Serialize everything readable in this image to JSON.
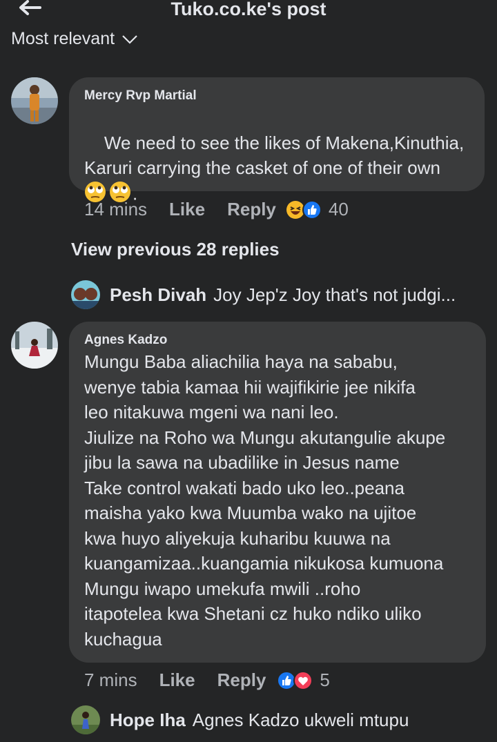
{
  "header": {
    "title": "Tuko.co.ke's post",
    "back_icon": "arrow-left-icon"
  },
  "sort": {
    "label": "Most relevant"
  },
  "comments": [
    {
      "author": "Mercy Rvp Martial",
      "text": "We need to see the likes of Makena,Kinuthia,\nKaruri carrying the casket of one of their own\n",
      "emoji_suffix": ".",
      "time": "14 mins",
      "like_label": "Like",
      "reply_label": "Reply",
      "reaction_count": "40",
      "reactions": [
        "haha",
        "like"
      ]
    },
    {
      "author": "Agnes Kadzo",
      "text": "Mungu Baba aliachilia haya na sababu,\nwenye tabia kamaa hii wajifikirie jee nikifa\nleo nitakuwa mgeni wa nani leo.\nJiulize na Roho wa Mungu akutangulie akupe\njibu la sawa na ubadilike in Jesus name\nTake control wakati bado uko leo..peana\nmaisha yako kwa Muumba wako na ujitoe\nkwa huyo aliyekuja kuharibu kuuwa na\nkuangamizaa..kuangamia nikukosa kumuona\nMungu iwapo umekufa mwili ..roho\nitapotelea kwa Shetani cz huko ndiko uliko\nkuchagua",
      "time": "7 mins",
      "like_label": "Like",
      "reply_label": "Reply",
      "reaction_count": "5",
      "reactions": [
        "like",
        "love"
      ]
    }
  ],
  "view_previous": "View previous 28 replies",
  "replies": [
    {
      "author": "Pesh Divah",
      "preview": "Joy Jep'z Joy that's not judgi..."
    },
    {
      "author": "Hope Iha",
      "preview": "Agnes Kadzo ukweli mtupu"
    }
  ],
  "colors": {
    "background": "#242526",
    "bubble": "#3a3b3c",
    "like_blue": "#1877f2",
    "love_red": "#f33e58",
    "haha_yellow": "#f7b928"
  }
}
